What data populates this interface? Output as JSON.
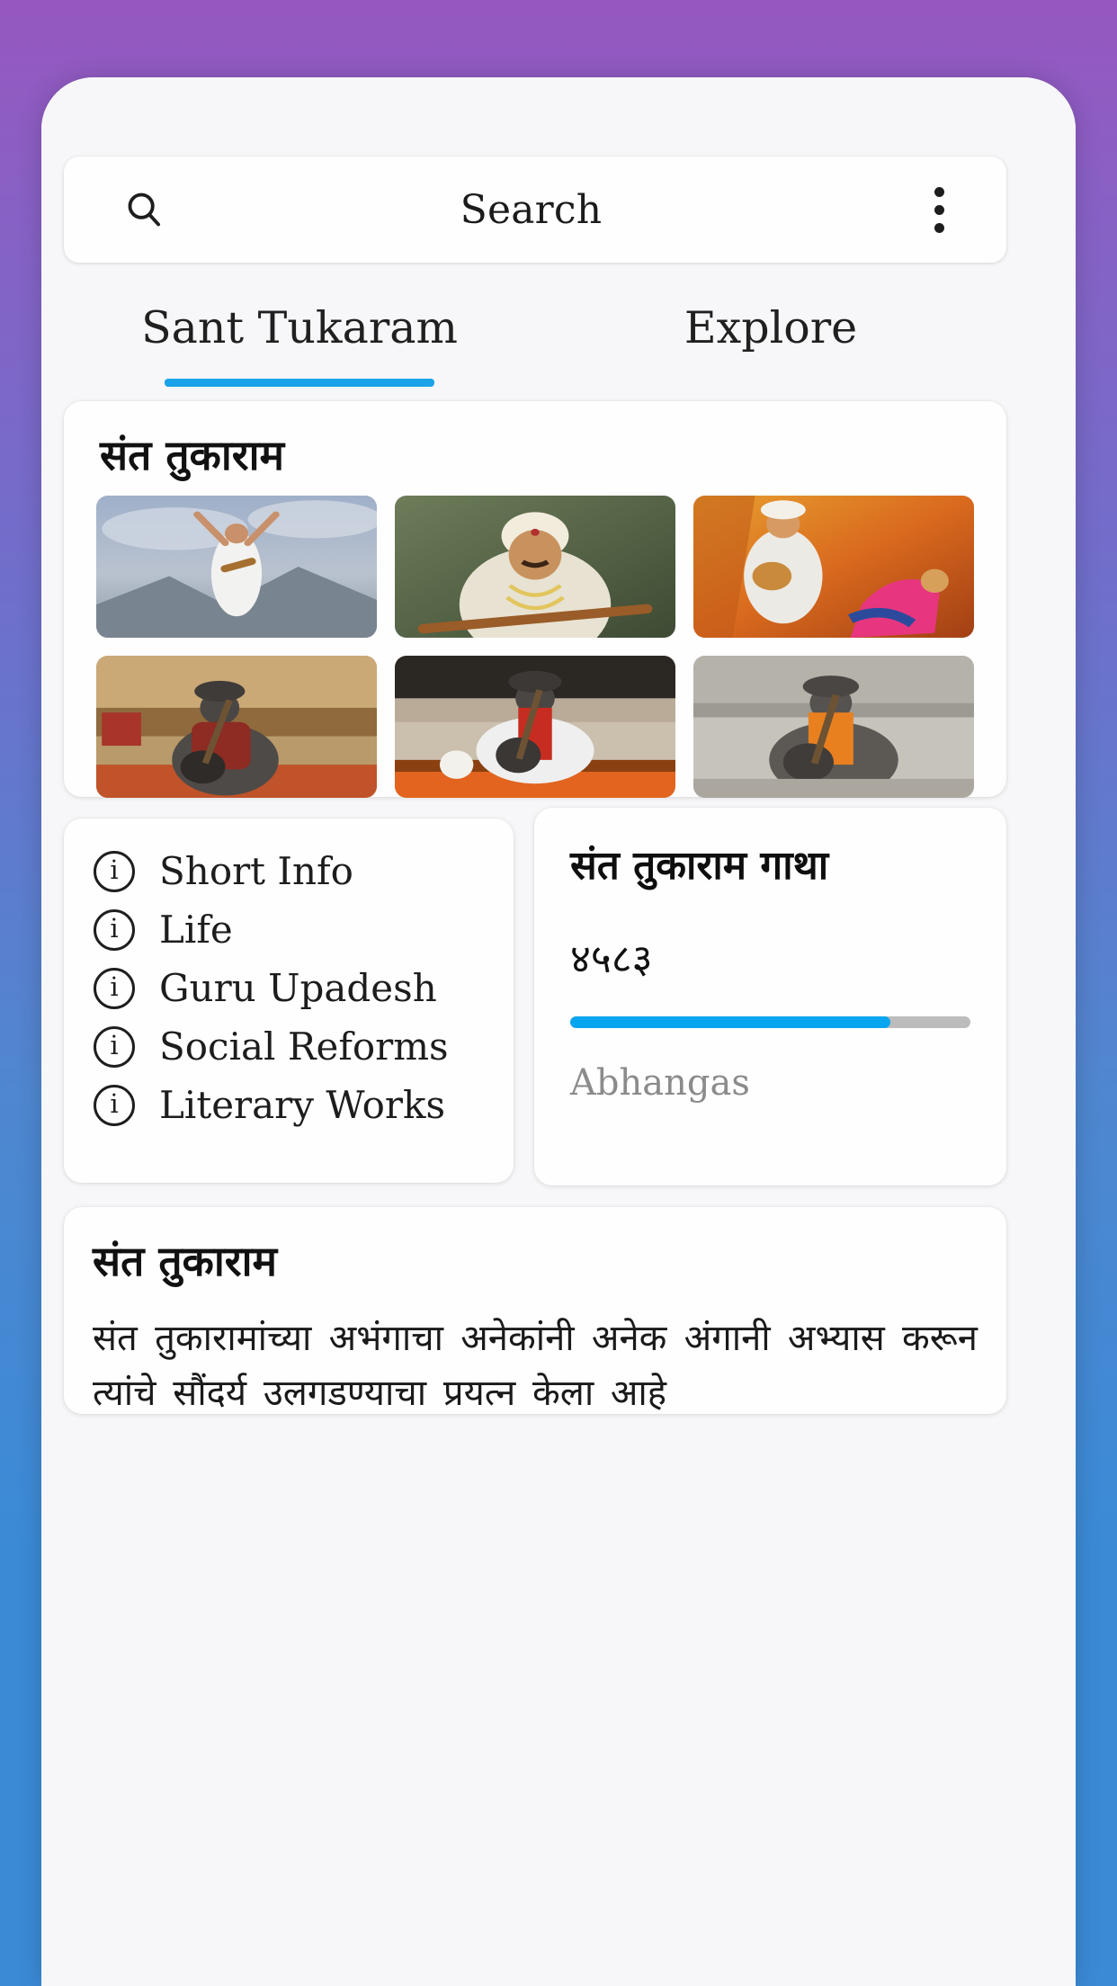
{
  "app": {
    "background_top_color": "#9657c0",
    "background_bottom_color": "#3b8ad6"
  },
  "search": {
    "icon": "search-icon",
    "label": "Search",
    "menu_icon": "more-vertical-icon"
  },
  "tabs": [
    {
      "label": "Sant Tukaram",
      "active": true
    },
    {
      "label": "Explore",
      "active": false
    }
  ],
  "gallery": {
    "title": "संत तुकाराम",
    "items": [
      {
        "alt": "tukaram-dancing-painting"
      },
      {
        "alt": "tukaram-portrait-painting"
      },
      {
        "alt": "tukaram-with-devotee-painting"
      },
      {
        "alt": "tukaram-statue-temple-left"
      },
      {
        "alt": "tukaram-statue-temple-center"
      },
      {
        "alt": "tukaram-statue-temple-right"
      }
    ]
  },
  "info_list": {
    "items": [
      {
        "icon": "info-icon",
        "label": "Short Info"
      },
      {
        "icon": "info-icon",
        "label": "Life"
      },
      {
        "icon": "info-icon",
        "label": "Guru Upadesh"
      },
      {
        "icon": "info-icon",
        "label": "Social Reforms"
      },
      {
        "icon": "info-icon",
        "label": "Literary Works"
      }
    ]
  },
  "gatha": {
    "title": "संत तुकाराम गाथा",
    "count": "४५८३",
    "progress_percent": 80,
    "progress_color": "#06a5ef",
    "track_color": "#bcbcbc",
    "subtitle": "Abhangas"
  },
  "description": {
    "title": "संत तुकाराम",
    "body": "संत तुकारामांच्या अभंगाचा अनेकांनी अनेक अंगानी अभ्यास करून त्यांचे सौंदर्य उलगडण्याचा प्रयत्न केला आहे"
  }
}
